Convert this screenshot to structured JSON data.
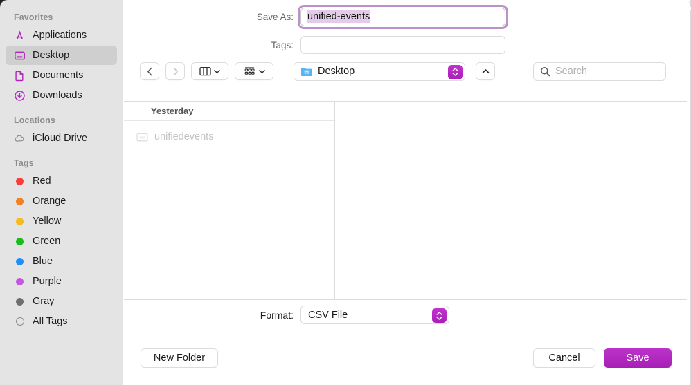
{
  "sidebar": {
    "sections": [
      {
        "header": "Favorites",
        "items": [
          {
            "label": "Applications",
            "icon": "applications-icon",
            "selected": false
          },
          {
            "label": "Desktop",
            "icon": "desktop-icon",
            "selected": true
          },
          {
            "label": "Documents",
            "icon": "documents-icon",
            "selected": false
          },
          {
            "label": "Downloads",
            "icon": "downloads-icon",
            "selected": false
          }
        ]
      },
      {
        "header": "Locations",
        "items": [
          {
            "label": "iCloud Drive",
            "icon": "icloud-drive-icon",
            "selected": false
          }
        ]
      },
      {
        "header": "Tags",
        "items": [
          {
            "label": "Red",
            "icon": "tag-dot-icon",
            "color": "#fc3d39",
            "selected": false
          },
          {
            "label": "Orange",
            "icon": "tag-dot-icon",
            "color": "#f38121",
            "selected": false
          },
          {
            "label": "Yellow",
            "icon": "tag-dot-icon",
            "color": "#f5bc1c",
            "selected": false
          },
          {
            "label": "Green",
            "icon": "tag-dot-icon",
            "color": "#14c017",
            "selected": false
          },
          {
            "label": "Blue",
            "icon": "tag-dot-icon",
            "color": "#1e8ef9",
            "selected": false
          },
          {
            "label": "Purple",
            "icon": "tag-dot-icon",
            "color": "#c martial",
            "selected": false
          },
          {
            "label": "Gray",
            "icon": "tag-dot-icon",
            "color": "#6e6e6e",
            "selected": false
          },
          {
            "label": "All Tags",
            "icon": "all-tags-icon",
            "color": "",
            "selected": false
          }
        ]
      }
    ]
  },
  "save_as": {
    "label": "Save As:",
    "value": "unified-events",
    "selected": true
  },
  "tags_field": {
    "label": "Tags:",
    "value": "",
    "placeholder": ""
  },
  "toolbar": {
    "back_icon": "chevron-left-icon",
    "forward_icon": "chevron-right-icon",
    "view_icon": "column-view-icon",
    "group_icon": "group-by-icon",
    "path_label": "Desktop",
    "path_icon": "desktop-folder-icon",
    "up_icon": "chevron-up-icon",
    "search_icon": "search-icon",
    "search_placeholder": "Search",
    "search_value": ""
  },
  "browser": {
    "group_header": "Yesterday",
    "files": [
      {
        "name": "unifiedevents",
        "icon": "file-icon",
        "dimmed": true
      }
    ]
  },
  "format": {
    "label": "Format:",
    "value": "CSV File"
  },
  "buttons": {
    "new_folder": "New Folder",
    "cancel": "Cancel",
    "save": "Save"
  },
  "colors": {
    "accent": "#b026bc",
    "accent_light": "#c132cf",
    "selection_highlight": "#e3cce8",
    "focus_ring": "#b07ec0",
    "sidebar_bg": "#e4e4e4",
    "folder_blue": "#57b4f5"
  }
}
